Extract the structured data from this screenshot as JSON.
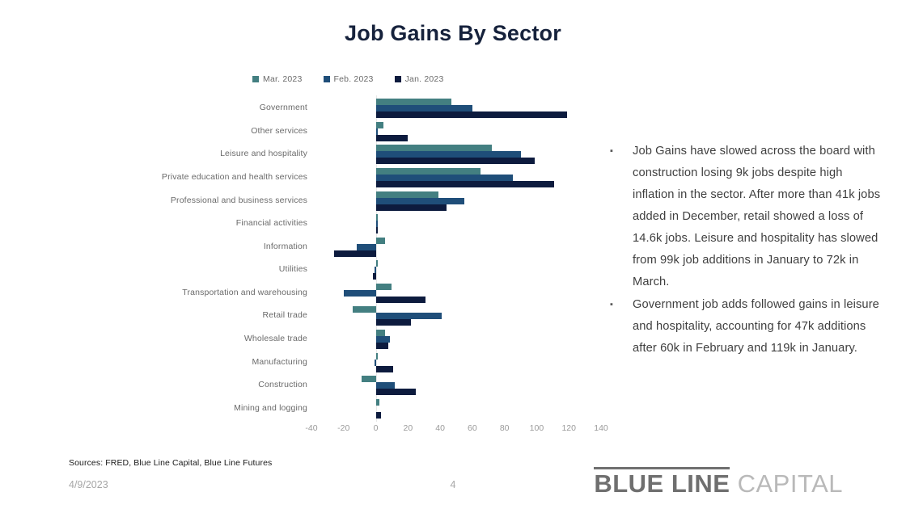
{
  "slide": {
    "title": "Job Gains By Sector",
    "sources": "Sources: FRED, Blue Line Capital, Blue Line Futures",
    "date": "4/9/2023",
    "page_number": "4",
    "logo_strong": "BLUE LINE",
    "logo_light": "CAPITAL",
    "bullet_marker": "▪"
  },
  "commentary": {
    "bullets": [
      "Job Gains have slowed across the board with construction losing 9k jobs despite high inflation in the sector. After more than 41k jobs added in December, retail showed a loss of 14.6k jobs. Leisure and hospitality has slowed from 99k job additions in January to 72k in March.",
      "Government job adds followed gains in leisure and hospitality, accounting for 47k additions after 60k in February and 119k in January."
    ]
  },
  "chart_data": {
    "type": "bar",
    "orientation": "horizontal",
    "title": "Job Gains By Sector",
    "xlabel": "",
    "ylabel": "",
    "xlim": [
      -40,
      140
    ],
    "xticks": [
      -40,
      -20,
      0,
      20,
      40,
      60,
      80,
      100,
      120,
      140
    ],
    "tick_labels": [
      "-40",
      "-20",
      "0",
      "20",
      "40",
      "60",
      "80",
      "100",
      "120",
      "140"
    ],
    "grid": false,
    "legend_position": "top-center",
    "categories": [
      "Government",
      "Other services",
      "Leisure and hospitality",
      "Private education and health services",
      "Professional and business services",
      "Financial activities",
      "Information",
      "Utilities",
      "Transportation and warehousing",
      "Retail trade",
      "Wholesale trade",
      "Manufacturing",
      "Construction",
      "Mining and logging"
    ],
    "series": [
      {
        "name": "Mar. 2023",
        "color": "#437f81",
        "values": [
          47,
          5,
          72,
          65,
          39,
          1,
          6,
          1,
          10,
          -14.6,
          6,
          1,
          -9,
          2
        ]
      },
      {
        "name": "Feb. 2023",
        "color": "#1f4e79",
        "values": [
          60,
          1,
          90,
          85,
          55,
          1,
          -12,
          -1,
          -20,
          41,
          9,
          -1,
          12,
          0
        ]
      },
      {
        "name": "Jan. 2023",
        "color": "#0d1b3e",
        "values": [
          119,
          20,
          99,
          111,
          44,
          1,
          -26,
          -2,
          31,
          22,
          8,
          11,
          25,
          3
        ]
      }
    ]
  }
}
